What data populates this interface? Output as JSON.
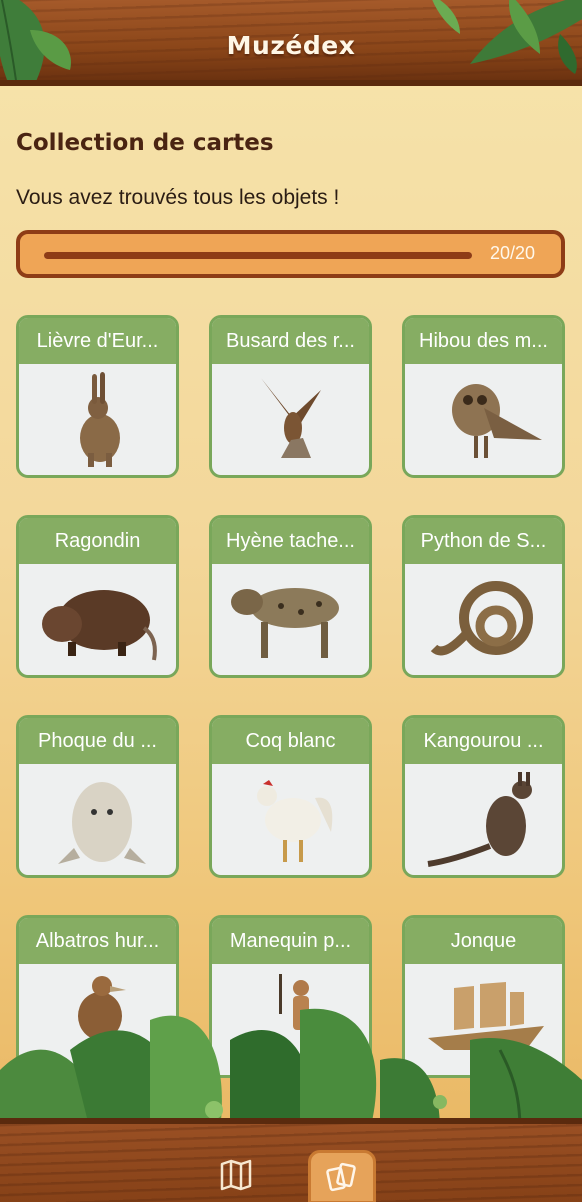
{
  "app": {
    "title": "Muzédex"
  },
  "page": {
    "section_title": "Collection de cartes",
    "status_text": "Vous avez trouvés tous les objets !"
  },
  "progress": {
    "label": "20/20",
    "found": 20,
    "total": 20
  },
  "cards": [
    {
      "label": "Lièvre d'Eur...",
      "icon": "hare"
    },
    {
      "label": "Busard des r...",
      "icon": "harrier"
    },
    {
      "label": "Hibou des m...",
      "icon": "owl"
    },
    {
      "label": "Ragondin",
      "icon": "coypu"
    },
    {
      "label": "Hyène tache...",
      "icon": "hyena"
    },
    {
      "label": "Python de S...",
      "icon": "python"
    },
    {
      "label": "Phoque du ...",
      "icon": "seal"
    },
    {
      "label": "Coq blanc",
      "icon": "rooster"
    },
    {
      "label": "Kangourou ...",
      "icon": "kangaroo"
    },
    {
      "label": "Albatros hur...",
      "icon": "albatross"
    },
    {
      "label": "Manequin p...",
      "icon": "mannequin"
    },
    {
      "label": "Jonque",
      "icon": "junk-ship"
    }
  ],
  "nav": {
    "map_icon": "map-icon",
    "cards_icon": "cards-icon",
    "active": "cards"
  },
  "colors": {
    "accent": "#86ad63",
    "progress_border": "#8e3c16",
    "progress_bg": "#efa556",
    "wood": "#8b4619"
  }
}
